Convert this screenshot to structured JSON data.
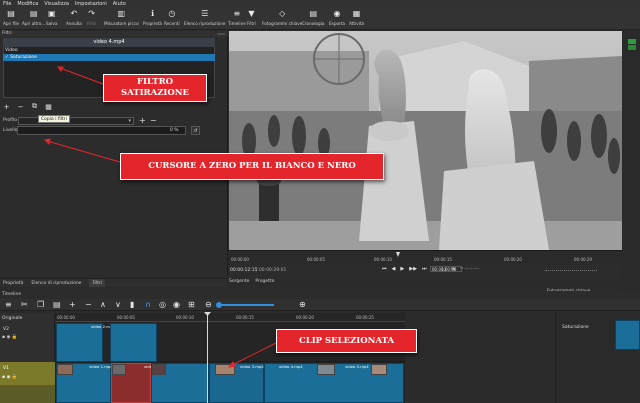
{
  "menu": [
    "File",
    "Modifica",
    "Visualizza",
    "Impostazioni",
    "Aiuto"
  ],
  "toolbar": [
    {
      "label": "Apri file",
      "icon": "folder-open-icon",
      "glyph": "▤"
    },
    {
      "label": "Apri altro...",
      "icon": "folder-dropdown-icon",
      "glyph": "▤"
    },
    {
      "label": "Salva",
      "icon": "save-icon",
      "glyph": "▣"
    },
    {
      "label": "Annulla",
      "icon": "undo-icon",
      "glyph": "↶"
    },
    {
      "label": "Rifai",
      "icon": "redo-icon",
      "glyph": "↷"
    },
    {
      "label": "Misuratore picco",
      "icon": "peak-meter-icon",
      "glyph": "▥"
    },
    {
      "label": "Proprietà",
      "icon": "info-icon",
      "glyph": "ℹ"
    },
    {
      "label": "Recenti",
      "icon": "clock-icon",
      "glyph": "◷"
    },
    {
      "label": "Elenco riproduzione",
      "icon": "list-icon",
      "glyph": "☰"
    },
    {
      "label": "Timeline",
      "icon": "timeline-icon",
      "glyph": "≡"
    },
    {
      "label": "Filtri",
      "icon": "filter-icon",
      "glyph": "▼"
    },
    {
      "label": "Fotogrammi chiave",
      "icon": "keyframes-icon",
      "glyph": "◇"
    },
    {
      "label": "Cronologia",
      "icon": "history-icon",
      "glyph": "▤"
    },
    {
      "label": "Esporta",
      "icon": "export-icon",
      "glyph": "◉"
    },
    {
      "label": "Attività",
      "icon": "jobs-icon",
      "glyph": "▦"
    }
  ],
  "filters": {
    "title": "Filtri",
    "clip_name": "video 4.mp4",
    "category": "Video",
    "filter_item": "✓ Saturazione",
    "tooltip": "Copia i filtri",
    "profile_label": "Profilo",
    "level_label": "Livello",
    "level_value": "0 %",
    "level_fraction": 0.0,
    "buttons": [
      "+",
      "−",
      "⧉",
      "▦"
    ]
  },
  "left_tabs": [
    "Proprietà",
    "Elenco di riproduzione",
    "Filtri"
  ],
  "player": {
    "ruler_labels": [
      "00:00:00",
      "00:00:05",
      "00:00:10",
      "00:00:15",
      "00:00:20",
      "00:00:29"
    ],
    "timecode": "00:00:12:15",
    "duration": "/ 00:00:29:01",
    "timecode2": "00:00:00:00",
    "timecode2_total": "--:--:--:--",
    "transport": [
      "⏮",
      "◀",
      "▶",
      "▶▶",
      "⏭",
      "⋮",
      "▢",
      "⊞",
      "▾"
    ],
    "tabs": [
      "Sorgente",
      "Progetto"
    ],
    "keyframes_tab": "Fotogrammi chiave"
  },
  "timeline": {
    "title": "Timeline",
    "ruler": [
      "00:00:00",
      "00:00:05",
      "00:00:10",
      "00:00:15",
      "00:00:20",
      "00:00:25"
    ],
    "tracks": [
      {
        "name": "Originale"
      },
      {
        "name": "V2"
      },
      {
        "name": "V1"
      }
    ],
    "clip_labels": [
      "video 2.mp4",
      "video 4.mp4",
      "video 1.mp4",
      "video 3.mp4",
      "video 4.mp4",
      "video 5.mp4"
    ],
    "keyframe_track": "Saturazione"
  },
  "annotations": {
    "filter_callout": "FILTRO SATIRAZIONE",
    "cursor_callout": "CURSORE A ZERO PER IL BIANCO E NERO",
    "clip_callout": "CLIP SELEZIONATA",
    "color": "#e4262c"
  }
}
